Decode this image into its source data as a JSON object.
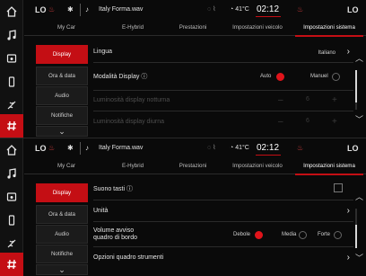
{
  "rail": [
    {
      "name": "home-icon",
      "glyph": "⌂"
    },
    {
      "name": "music-icon",
      "glyph": "♫"
    },
    {
      "name": "car-icon",
      "glyph": "⛟"
    },
    {
      "name": "phone-icon",
      "glyph": "▯"
    },
    {
      "name": "climate-icon",
      "glyph": "≈"
    },
    {
      "name": "settings-icon",
      "glyph": "#"
    }
  ],
  "status": {
    "lo_left": "LO",
    "lo_right": "LO",
    "track": "Italy Forma.wav",
    "temp_value": "41°C",
    "temp_unit": "BH",
    "time": "02:12"
  },
  "tabs": [
    "My Car",
    "E-Hybrid",
    "Prestazioni",
    "Impostazioni veicolo",
    "Impostazioni sistema"
  ],
  "active_tab": "Impostazioni sistema",
  "top": {
    "submenu": [
      "Display",
      "Ora & data",
      "Audio",
      "Notifiche"
    ],
    "rows": {
      "lingua_label": "Lingua",
      "lingua_value": "Italiano",
      "modalita_label": "Modalità Display",
      "auto_label": "Auto",
      "manuel_label": "Manuel",
      "notturna_label": "Luminosità display notturna",
      "notturna_value": "6",
      "diurna_label": "Luminosità display diurna",
      "diurna_value": "6"
    }
  },
  "bottom": {
    "submenu": [
      "Display",
      "Ora & data",
      "Audio",
      "Notifiche"
    ],
    "rows": {
      "suono_label": "Suono tasti",
      "unita_label": "Unità",
      "volume_label_1": "Volume avviso",
      "volume_label_2": "quadro di bordo",
      "debole_label": "Debole",
      "media_label": "Media",
      "forte_label": "Forte",
      "opzioni_label": "Opzioni quadro strumenti"
    }
  },
  "colors": {
    "accent": "#c40e14",
    "radio_on": "#e0141b"
  }
}
